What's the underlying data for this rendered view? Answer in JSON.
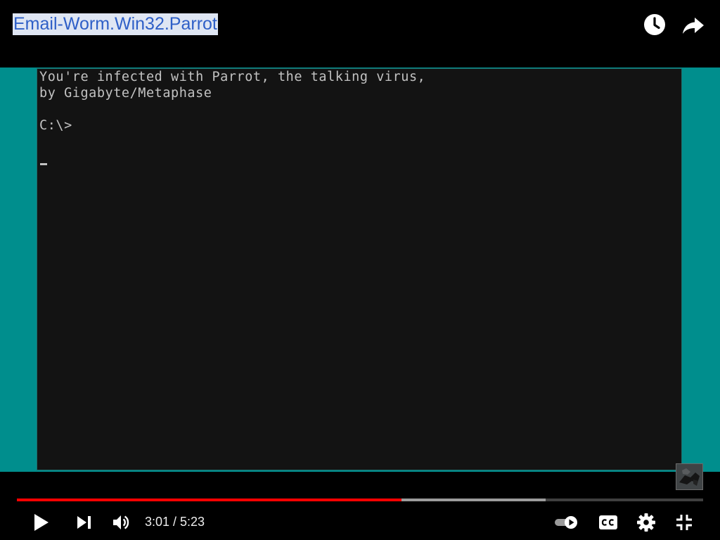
{
  "title": {
    "text": "Email-Worm.Win32.Parrot"
  },
  "top_actions": [
    {
      "icon": "clock-icon",
      "label": "Watch later"
    },
    {
      "icon": "share-arrow-icon",
      "label": "Share"
    }
  ],
  "terminal": {
    "lines": [
      "You're infected with Parrot, the talking virus,",
      "by Gigabyte/Metaphase",
      "C:\\>"
    ]
  },
  "player": {
    "current_time": "3:01",
    "duration": "5:23",
    "time_text": "3:01 / 5:23",
    "played_fraction": 0.56,
    "buffered_fraction": 0.771
  },
  "colors": {
    "accent": "#ff0000",
    "desktop_bg": "#008e8d",
    "terminal_bg": "#131313",
    "terminal_text": "#c2c2c2",
    "title_text": "#2e5fc7"
  },
  "icons": {
    "play": "play-icon",
    "next": "next-track-icon",
    "volume": "volume-icon",
    "autoplay": "autoplay-toggle-icon",
    "captions": "closed-captions-icon",
    "settings": "gear-icon",
    "exit_fullscreen": "exit-fullscreen-icon"
  }
}
